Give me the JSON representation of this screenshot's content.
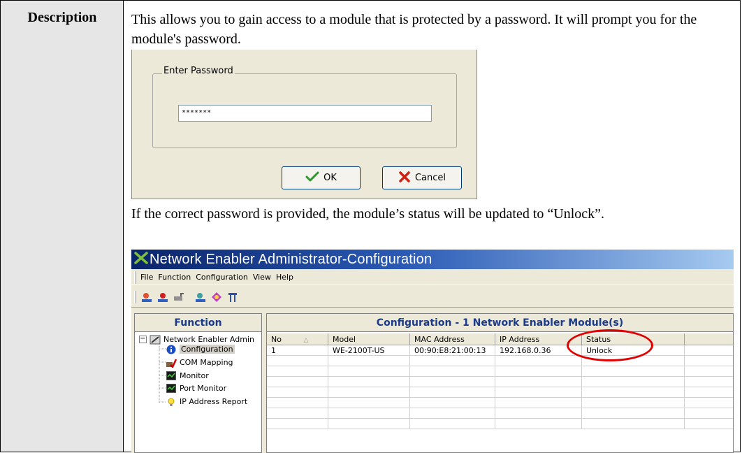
{
  "row_label": "Description",
  "paragraphs": {
    "intro": "This allows you to gain access to a module that is protected by a password. It will prompt you for the module's password.",
    "result": "If the correct password is provided, the module’s status will be updated to “Unlock”."
  },
  "password_dialog": {
    "group_label": "Enter Password",
    "password_value": "*******",
    "ok_label": "OK",
    "cancel_label": "Cancel"
  },
  "app_window": {
    "title": "Network Enabler Administrator-Configuration",
    "menu": [
      "File",
      "Function",
      "Configuration",
      "View",
      "Help"
    ],
    "toolbar_icons": [
      "search-module-icon",
      "locate-module-icon",
      "unlock-module-icon",
      "import-icon",
      "export-icon",
      "upgrade-icon"
    ],
    "function_header": "Function",
    "tree": {
      "root": "Network Enabler Admin",
      "children": [
        "Configuration",
        "COM Mapping",
        "Monitor",
        "Port Monitor",
        "IP Address Report"
      ]
    },
    "config_header": "Configuration - 1 Network Enabler Module(s)",
    "columns": [
      "No",
      "Model",
      "MAC Address",
      "IP Address",
      "Status",
      ""
    ],
    "rows": [
      [
        "1",
        "WE-2100T-US",
        "00:90:E8:21:00:13",
        "192.168.0.36",
        "Unlock",
        ""
      ]
    ],
    "colors": {
      "highlight_circle": "#e00000",
      "header_text": "#1a3a8a"
    }
  }
}
